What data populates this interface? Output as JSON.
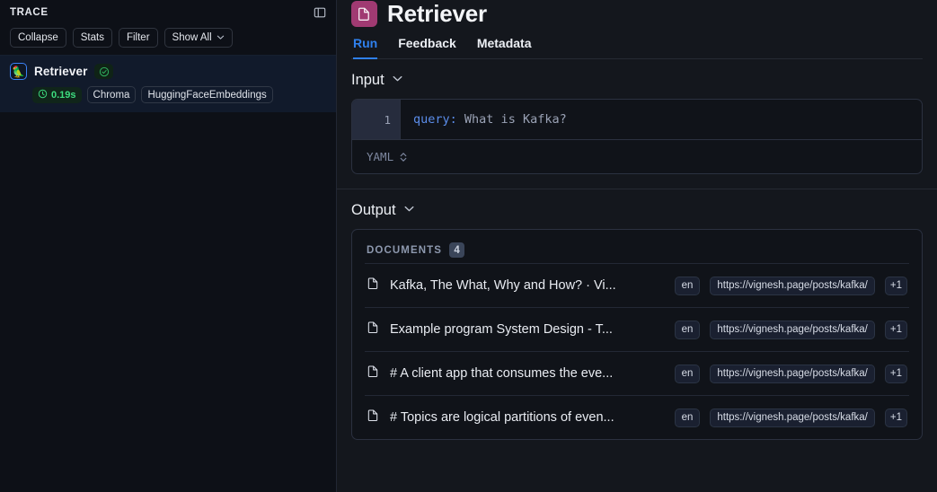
{
  "sidebar": {
    "title": "TRACE",
    "panel_toggle_icon": "sidebar-panel-icon",
    "toolbar": [
      {
        "label": "Collapse",
        "icon": null
      },
      {
        "label": "Stats",
        "icon": null
      },
      {
        "label": "Filter",
        "icon": null
      },
      {
        "label": "Show All",
        "icon": "chevron-down-icon"
      }
    ],
    "node": {
      "icon": "🦜",
      "name": "Retriever",
      "status_icon": "check-circle-icon",
      "duration": "0.19s",
      "duration_icon": "clock-icon",
      "tags": [
        "Chroma",
        "HuggingFaceEmbeddings"
      ]
    }
  },
  "header": {
    "icon": "document-icon",
    "icon_color": "#a03a72",
    "title": "Retriever",
    "tabs": [
      {
        "label": "Run",
        "active": true
      },
      {
        "label": "Feedback",
        "active": false
      },
      {
        "label": "Metadata",
        "active": false
      }
    ],
    "accent_color": "#2f80ed"
  },
  "input": {
    "title": "Input",
    "collapse_icon": "chevron-down-icon",
    "line_number": "1",
    "code_key": "query:",
    "code_value": "What is Kafka?",
    "format": "YAML",
    "format_icon": "chevron-up-down-icon"
  },
  "output": {
    "title": "Output",
    "collapse_icon": "chevron-down-icon",
    "documents_label": "DOCUMENTS",
    "documents_count": "4",
    "documents": [
      {
        "icon": "file-icon",
        "title": "Kafka, The What, Why and How? · Vi...",
        "lang": "en",
        "url": "https://vignesh.page/posts/kafka/",
        "more": "+1"
      },
      {
        "icon": "file-icon",
        "title": "Example program System Design - T...",
        "lang": "en",
        "url": "https://vignesh.page/posts/kafka/",
        "more": "+1"
      },
      {
        "icon": "file-icon",
        "title": "# A client app that consumes the eve...",
        "lang": "en",
        "url": "https://vignesh.page/posts/kafka/",
        "more": "+1"
      },
      {
        "icon": "file-icon",
        "title": "# Topics are logical partitions of even...",
        "lang": "en",
        "url": "https://vignesh.page/posts/kafka/",
        "more": "+1"
      }
    ]
  }
}
